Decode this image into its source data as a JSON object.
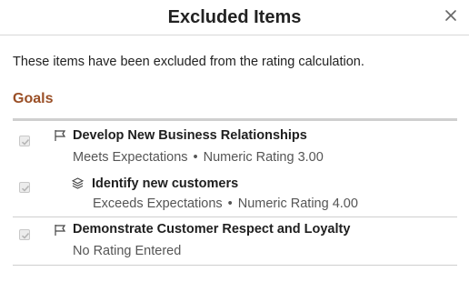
{
  "dialog": {
    "title": "Excluded Items",
    "close_label": "close-icon"
  },
  "intro_text": "These items have been excluded from the rating calculation.",
  "section": {
    "title": "Goals"
  },
  "items": [
    {
      "title": "Develop New Business Relationships",
      "rating": "Meets Expectations",
      "separator": "•",
      "numeric": "Numeric Rating 3.00",
      "icon": "flag-icon",
      "checked": true
    },
    {
      "title": "Identify new customers",
      "rating": "Exceeds Expectations",
      "separator": "•",
      "numeric": "Numeric Rating 4.00",
      "icon": "layers-icon",
      "checked": true
    },
    {
      "title": "Demonstrate Customer Respect and Loyalty",
      "rating": "No Rating Entered",
      "icon": "flag-icon",
      "checked": true
    }
  ]
}
